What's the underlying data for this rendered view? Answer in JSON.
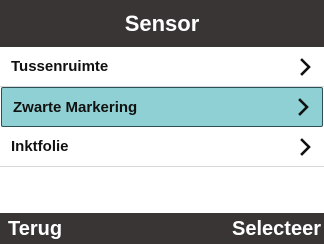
{
  "header": {
    "title": "Sensor"
  },
  "menu": {
    "items": [
      {
        "label": "Tussenruimte",
        "selected": false,
        "icon": "chevron-right-icon"
      },
      {
        "label": "Zwarte Markering",
        "selected": true,
        "icon": "chevron-right-icon"
      },
      {
        "label": "Inktfolie",
        "selected": false,
        "icon": "chevron-right-icon"
      }
    ]
  },
  "footer": {
    "left_softkey": "Terug",
    "right_softkey": "Selecteer"
  },
  "colors": {
    "bar_background": "#383534",
    "selection_background": "#8ed0d3",
    "selection_border": "#2f4f58"
  }
}
